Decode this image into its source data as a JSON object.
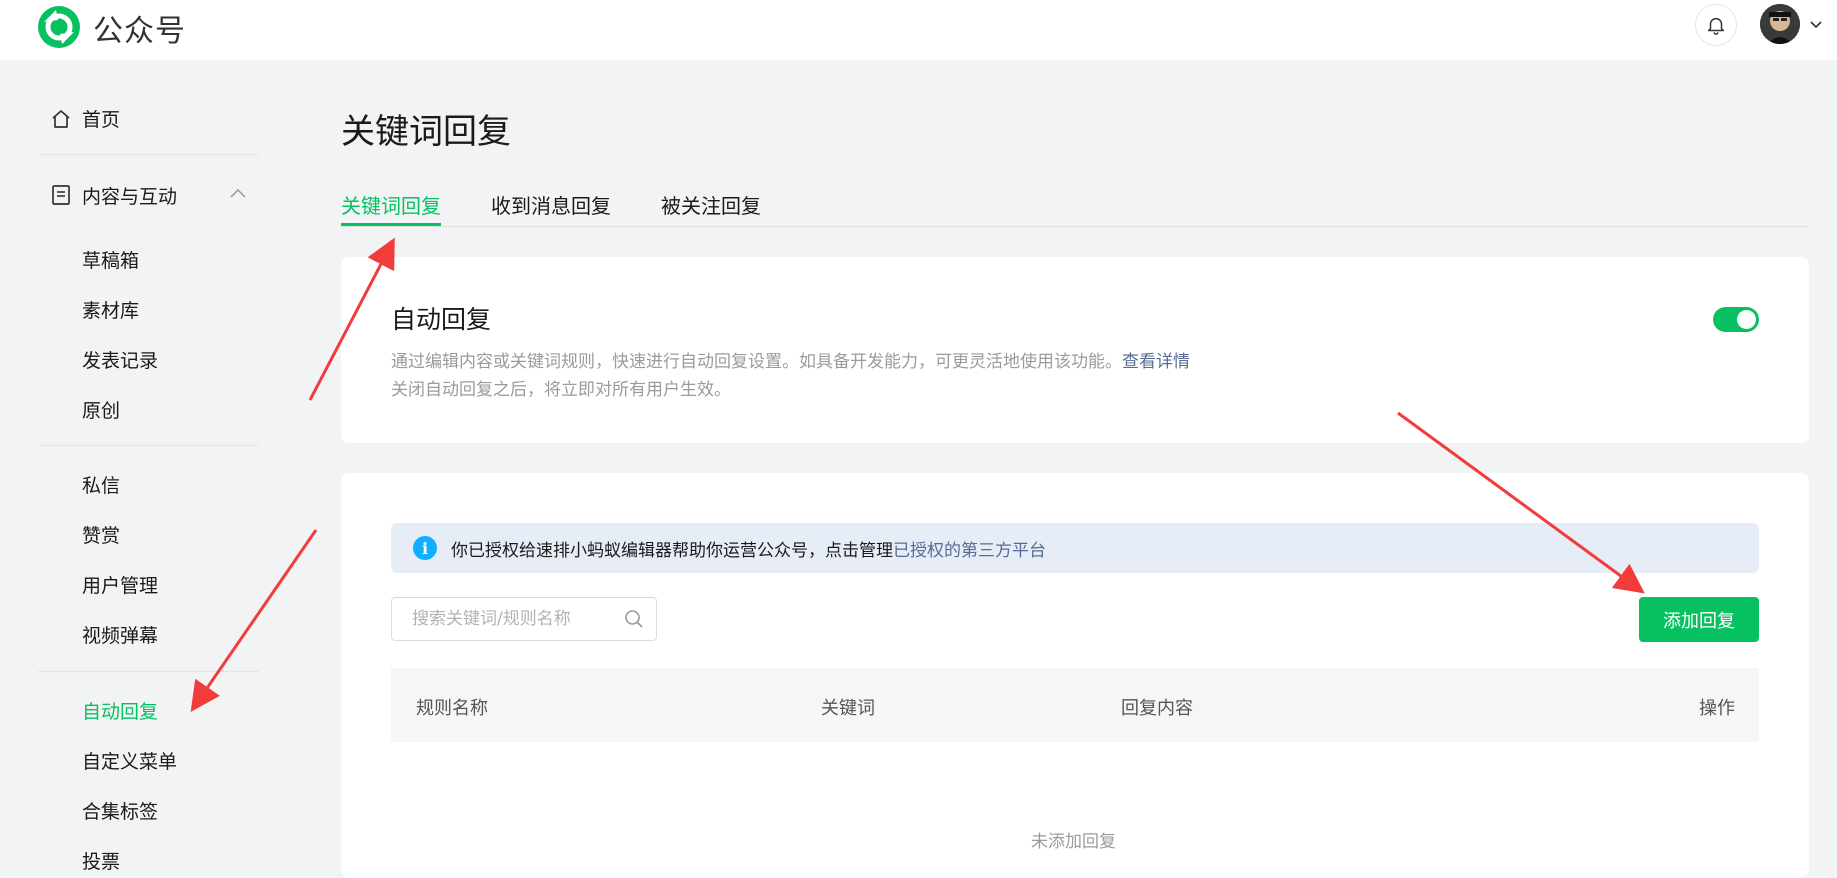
{
  "topbar": {
    "brand": "公众号",
    "logo_icon": "wechat-official-account-logo",
    "bell_icon": "bell-icon",
    "avatar": "user-avatar"
  },
  "sidebar": {
    "home": "首页",
    "content_group": "内容与互动",
    "content_items": [
      "草稿箱",
      "素材库",
      "发表记录",
      "原创"
    ],
    "interact_items": [
      "私信",
      "赞赏",
      "用户管理",
      "视频弹幕"
    ],
    "function_items": [
      "自动回复",
      "自定义菜单",
      "合集标签",
      "投票"
    ],
    "active_item": "自动回复"
  },
  "main": {
    "title": "关键词回复",
    "tabs": [
      {
        "label": "关键词回复",
        "active": true
      },
      {
        "label": "收到消息回复",
        "active": false
      },
      {
        "label": "被关注回复",
        "active": false
      }
    ],
    "auto_reply": {
      "title": "自动回复",
      "desc_line1": "通过编辑内容或关键词规则，快速进行自动回复设置。如具备开发能力，可更灵活地使用该功能。",
      "desc_link": "查看详情",
      "desc_line2": "关闭自动回复之后，将立即对所有用户生效。",
      "enabled": true
    },
    "notice": {
      "text": "你已授权给速排小蚂蚁编辑器帮助你运营公众号，点击管理",
      "link": "已授权的第三方平台"
    },
    "search": {
      "placeholder": "搜索关键词/规则名称"
    },
    "add_button": "添加回复",
    "table": {
      "columns": [
        "规则名称",
        "关键词",
        "回复内容",
        "操作"
      ]
    },
    "empty_text": "未添加回复"
  },
  "colors": {
    "accent": "#07c160",
    "link": "#576b95",
    "annotation_arrow": "#f23c3c",
    "info": "#10aeff"
  }
}
